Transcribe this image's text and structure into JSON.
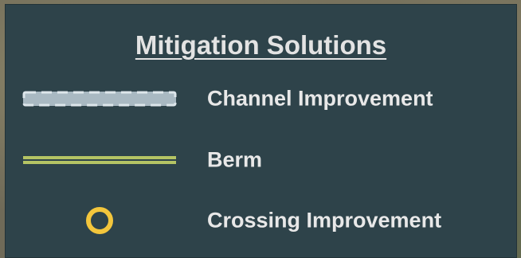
{
  "legend": {
    "title": "Mitigation Solutions",
    "items": [
      {
        "label": "Channel Improvement",
        "symbol": "dashed-channel-line-icon",
        "fill_color": "#a9b9c2",
        "dash_color": "#dde6eb"
      },
      {
        "label": "Berm",
        "symbol": "double-line-icon",
        "color": "#b5c464"
      },
      {
        "label": "Crossing Improvement",
        "symbol": "ring-icon",
        "color": "#f3c63c"
      }
    ]
  },
  "colors": {
    "panel_background": "#2e434a",
    "text": "#e8e8e8"
  }
}
